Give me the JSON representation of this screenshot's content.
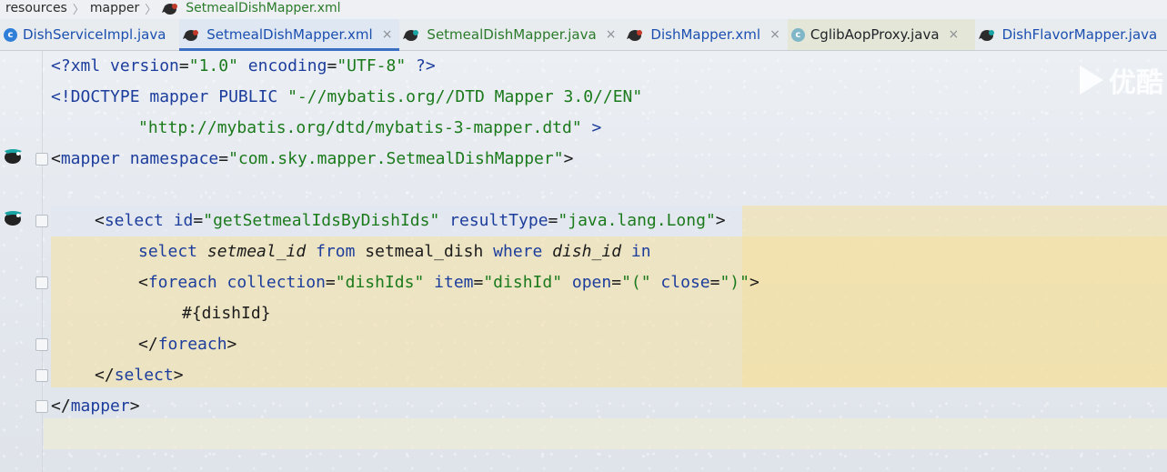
{
  "breadcrumb": {
    "items": [
      "resources",
      "mapper"
    ],
    "active": "SetmealDishMapper.xml"
  },
  "tabs": [
    {
      "label": "DishServiceImpl.java",
      "icon": "c-class-icon",
      "close": ""
    },
    {
      "label": "SetmealDishMapper.xml",
      "icon": "mybatis-bird-icon",
      "close": "×"
    },
    {
      "label": "SetmealDishMapper.java",
      "icon": "mybatis-bird-icon",
      "close": "×"
    },
    {
      "label": "DishMapper.xml",
      "icon": "mybatis-bird-icon",
      "close": "×"
    },
    {
      "label": "CglibAopProxy.java",
      "icon": "c-class-icon",
      "close": "×"
    },
    {
      "label": "DishFlavorMapper.java",
      "icon": "mybatis-bird-icon",
      "close": ""
    }
  ],
  "code": {
    "l1": {
      "a": "<?",
      "b": "xml version",
      "c": "=",
      "d": "\"1.0\"",
      "e": " encoding",
      "f": "=",
      "g": "\"UTF-8\"",
      "h": " ?>"
    },
    "l2": {
      "a": "<!DOCTYPE mapper PUBLIC ",
      "b": "\"-//mybatis.org//DTD Mapper 3.0//EN\""
    },
    "l3": {
      "a": "\"http://mybatis.org/dtd/mybatis-3-mapper.dtd\"",
      "b": " >"
    },
    "l4": {
      "a": "<",
      "b": "mapper",
      "c": " namespace",
      "d": "=",
      "e": "\"com.sky.mapper.SetmealDishMapper\"",
      "f": ">"
    },
    "l6": {
      "a": "<",
      "b": "select",
      "c": " id",
      "d": "=",
      "e": "\"getSetmealIdsByDishIds\"",
      "f": " resultType",
      "g": "=",
      "h": "\"java.lang.Long\"",
      "i": ">"
    },
    "l7": {
      "a": "select ",
      "b": "setmeal_id",
      "c": " from ",
      "d": "setmeal_dish",
      "e": " where ",
      "f": "dish_id",
      "g": " in"
    },
    "l8": {
      "a": "<",
      "b": "foreach",
      "c": " collection",
      "d": "=",
      "e": "\"dishIds\"",
      "f": " item",
      "g": "=",
      "h": "\"dishId\"",
      "i": " open",
      "j": "=",
      "k": "\"(\"",
      "l": " close",
      "m": "=",
      "n": "\")\"",
      "o": ">"
    },
    "l9": {
      "a": "#{dishId}"
    },
    "l10": {
      "a": "</",
      "b": "foreach",
      "c": ">"
    },
    "l11": {
      "a": "</",
      "b": "select",
      "c": ">"
    },
    "l12": {
      "a": "</",
      "b": "mapper",
      "c": ">"
    }
  },
  "watermark": {
    "text": "优酷"
  },
  "colors": {
    "tag": "#1c3d9c",
    "value": "#1b7a1b",
    "highlight": "#f4e0a0",
    "activeTab": "#3b6fc4"
  }
}
